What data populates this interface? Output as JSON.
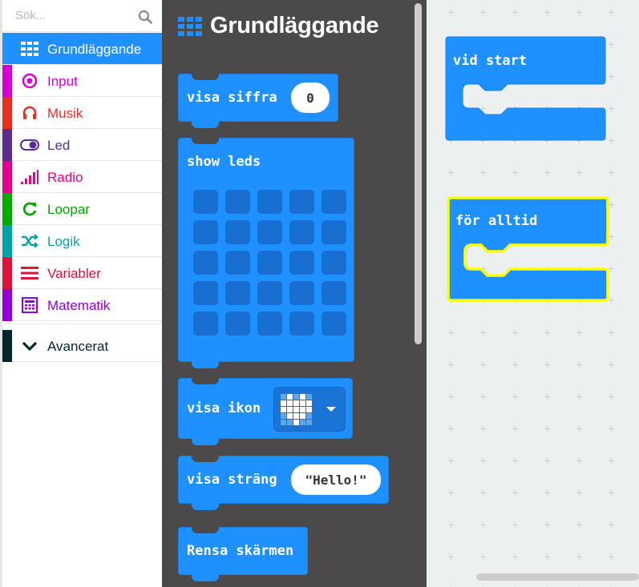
{
  "search": {
    "placeholder": "Sök..."
  },
  "toolbox": {
    "categories": [
      {
        "label": "Grundläggande",
        "color": "#1e90ff",
        "icon": "grid-icon"
      },
      {
        "label": "Input",
        "color": "#d400d4",
        "icon": "target-icon"
      },
      {
        "label": "Musik",
        "color": "#e63022",
        "icon": "headphones-icon"
      },
      {
        "label": "Led",
        "color": "#5c2d91",
        "icon": "toggle-icon"
      },
      {
        "label": "Radio",
        "color": "#e3008c",
        "icon": "signal-icon"
      },
      {
        "label": "Loopar",
        "color": "#00aa00",
        "icon": "refresh-icon"
      },
      {
        "label": "Logik",
        "color": "#00a4a6",
        "icon": "shuffle-icon"
      },
      {
        "label": "Variabler",
        "color": "#dc143c",
        "icon": "lines-icon"
      },
      {
        "label": "Matematik",
        "color": "#9400d3",
        "icon": "calculator-icon"
      }
    ],
    "advanced": {
      "label": "Avancerat",
      "color": "#00272b",
      "icon": "chevron-down-icon"
    }
  },
  "flyout": {
    "title": "Grundläggande",
    "blocks": {
      "show_number": {
        "label": "visa siffra",
        "value": "0"
      },
      "show_leds": {
        "label": "show leds"
      },
      "show_icon": {
        "label": "visa ikon"
      },
      "show_string": {
        "label": "visa sträng",
        "value": "\"Hello!\""
      },
      "clear_screen": {
        "label": "Rensa skärmen"
      }
    }
  },
  "workspace": {
    "on_start": {
      "label": "vid start"
    },
    "forever": {
      "label": "för alltid",
      "highlight": "#ffff00"
    }
  },
  "colors": {
    "basic_block": "#1e90ff",
    "flyout_bg": "#4b4949",
    "workspace_bg": "#ecf0f1"
  }
}
